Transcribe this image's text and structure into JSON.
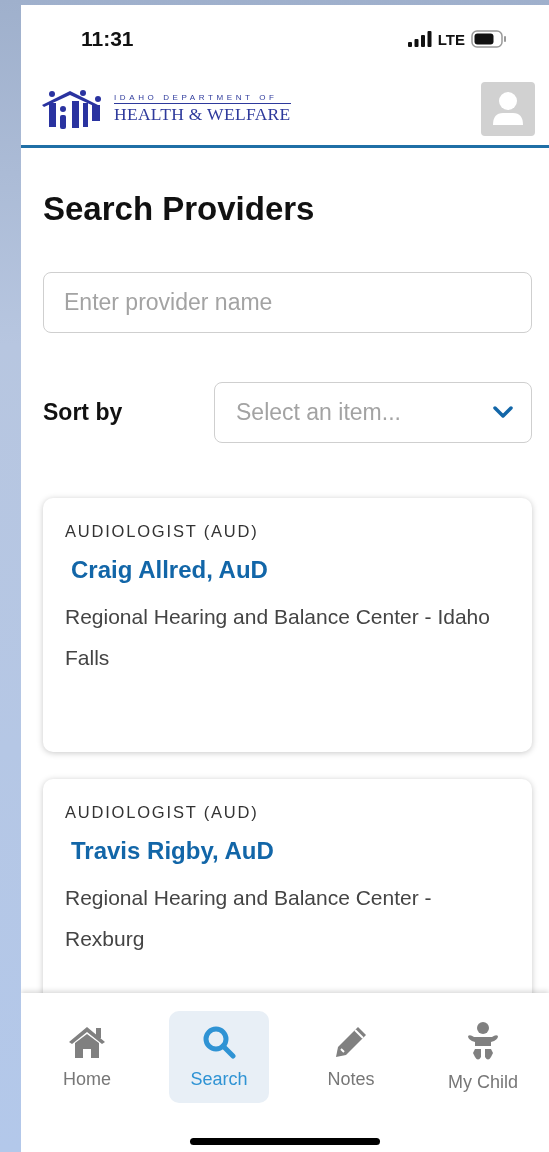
{
  "status_bar": {
    "time": "11:31",
    "network": "LTE"
  },
  "header": {
    "logo_top": "IDAHO DEPARTMENT OF",
    "logo_bottom": "HEALTH & WELFARE"
  },
  "title": "Search Providers",
  "search": {
    "placeholder": "Enter provider name"
  },
  "sort": {
    "label": "Sort by",
    "placeholder": "Select an item..."
  },
  "providers": [
    {
      "category": "AUDIOLOGIST (AUD)",
      "name": "Craig Allred, AuD",
      "location": "Regional Hearing and Balance Center - Idaho Falls"
    },
    {
      "category": "AUDIOLOGIST (AUD)",
      "name": "Travis Rigby, AuD",
      "location": "Regional Hearing and Balance Center - Rexburg"
    }
  ],
  "tab_bar": [
    {
      "kind": "home",
      "label": "Home",
      "selected": false
    },
    {
      "kind": "search",
      "label": "Search",
      "selected": true
    },
    {
      "kind": "notes",
      "label": "Notes",
      "selected": false
    },
    {
      "kind": "child",
      "label": "My Child",
      "selected": false
    }
  ]
}
